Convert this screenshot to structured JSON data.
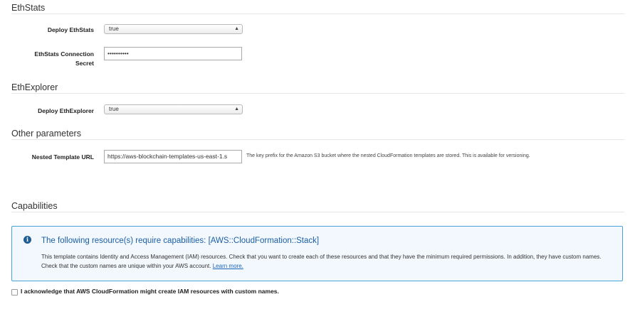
{
  "sections": {
    "ethstats": "EthStats",
    "ethexplorer": "EthExplorer",
    "other": "Other parameters",
    "capabilities": "Capabilities"
  },
  "fields": {
    "deploy_ethstats": {
      "label": "Deploy EthStats",
      "value": "true"
    },
    "ethstats_secret": {
      "label_line1": "EthStats Connection",
      "label_line2": "Secret",
      "value": "••••••••••"
    },
    "deploy_ethexplorer": {
      "label": "Deploy EthExplorer",
      "value": "true"
    },
    "nested_template_url": {
      "label": "Nested Template URL",
      "value": "https://aws-blockchain-templates-us-east-1.s",
      "help": "The key prefix for the Amazon S3 bucket where the nested CloudFormation templates are stored. This is available for versioning."
    }
  },
  "capabilities_notice": {
    "title": "The following resource(s) require capabilities: [AWS::CloudFormation::Stack]",
    "body": "This template contains Identity and Access Management (IAM) resources. Check that you want to create each of these resources and that they have the minimum required permissions. In addition, they have custom names. Check that the custom names are unique within your AWS account.",
    "link": "Learn more."
  },
  "acknowledge": {
    "label": "I acknowledge that AWS CloudFormation might create IAM resources with custom names.",
    "checked": false
  },
  "colors": {
    "info_border": "#4aa3d8",
    "info_title": "#1a5ea8",
    "link": "#1a64b7"
  }
}
